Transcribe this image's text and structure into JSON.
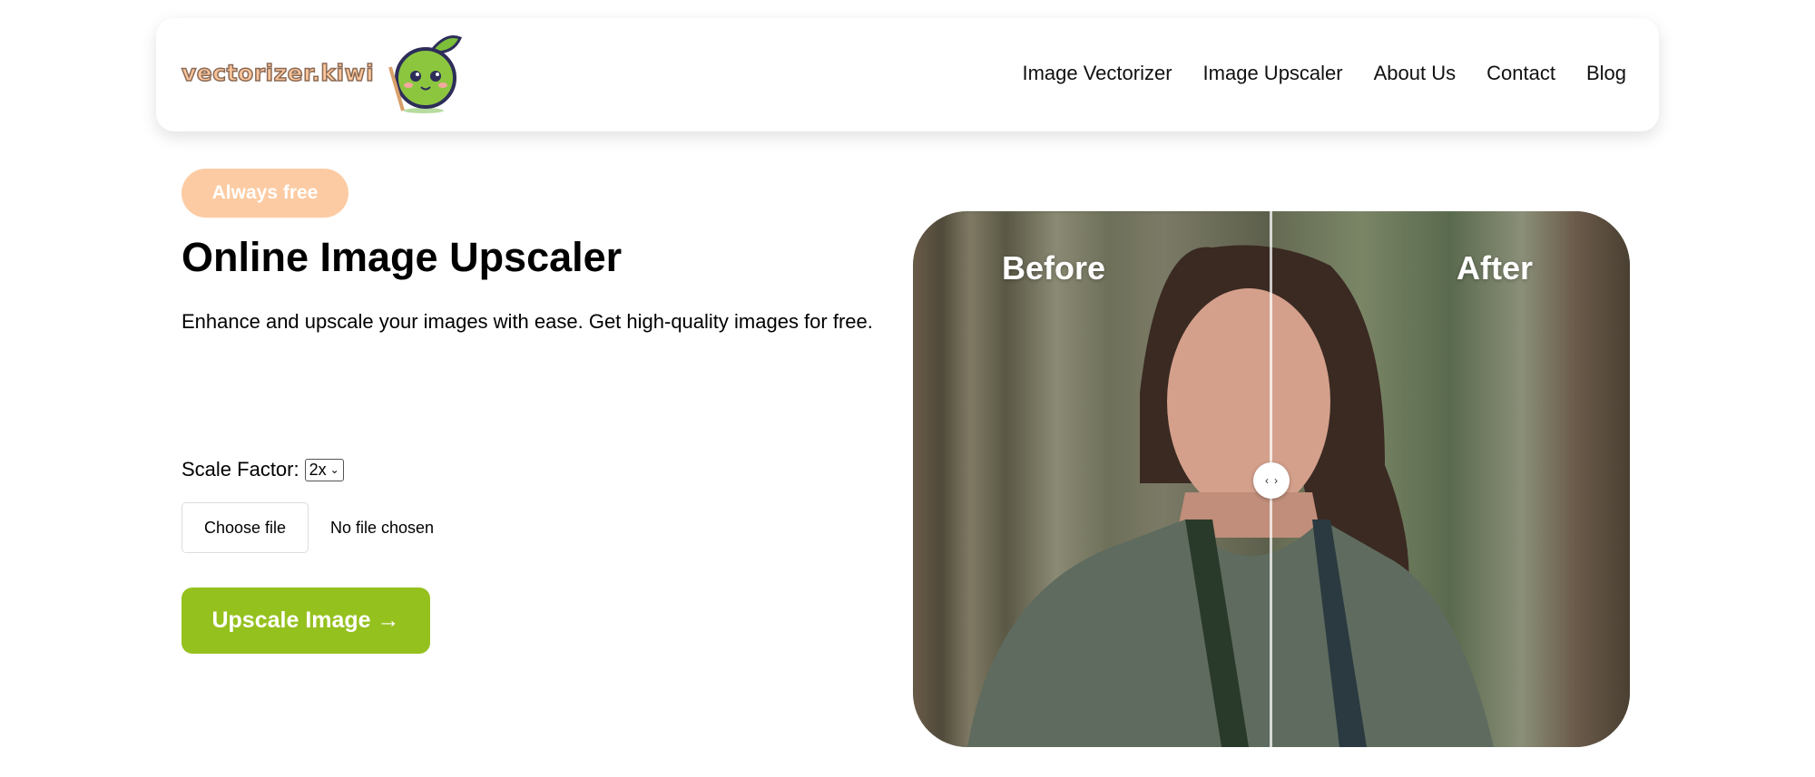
{
  "header": {
    "logo_text": "vectorizer.kiwi",
    "nav": [
      "Image Vectorizer",
      "Image Upscaler",
      "About Us",
      "Contact",
      "Blog"
    ]
  },
  "hero": {
    "badge": "Always free",
    "title": "Online Image Upscaler",
    "description": "Enhance and upscale your images with ease. Get high-quality images for free."
  },
  "form": {
    "scale_label": "Scale Factor:",
    "scale_value": "2x",
    "choose_file": "Choose file",
    "file_status": "No file chosen",
    "submit": "Upscale Image →"
  },
  "compare": {
    "before": "Before",
    "after": "After",
    "handle_left": "‹",
    "handle_right": "›"
  },
  "colors": {
    "accent": "#95c11f",
    "badge": "#fccba3"
  }
}
